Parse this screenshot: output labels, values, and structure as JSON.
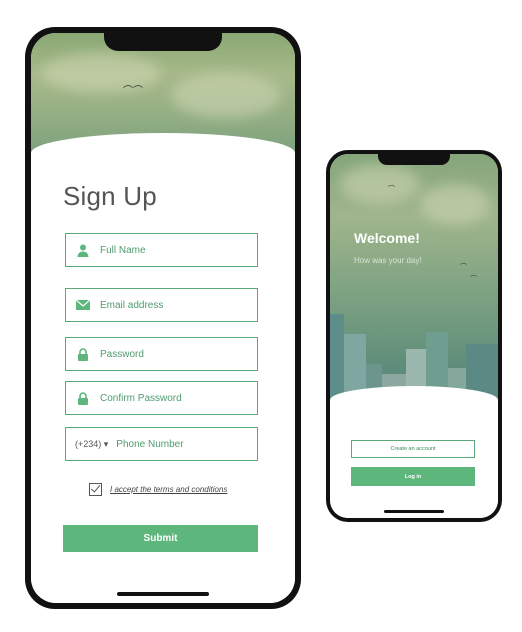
{
  "signup": {
    "title": "Sign Up",
    "fields": [
      {
        "icon": "person-icon",
        "placeholder": "Full Name"
      },
      {
        "icon": "envelope-icon",
        "placeholder": "Email address"
      },
      {
        "icon": "lock-icon",
        "placeholder": "Password"
      },
      {
        "icon": "lock-icon",
        "placeholder": "Confirm Password"
      }
    ],
    "phone": {
      "country_code": "(+234) ▾",
      "placeholder": "Phone Number"
    },
    "terms_label": "I accept the terms and conditions",
    "terms_checked": true,
    "submit_label": "Submit"
  },
  "welcome": {
    "title": "Welcome!",
    "subtitle": "How was your day!",
    "create_account_label": "Create an account",
    "login_label": "Log in"
  },
  "colors": {
    "accent": "#5db77d",
    "accent_border": "#5aa77a",
    "text_gray": "#555555"
  }
}
